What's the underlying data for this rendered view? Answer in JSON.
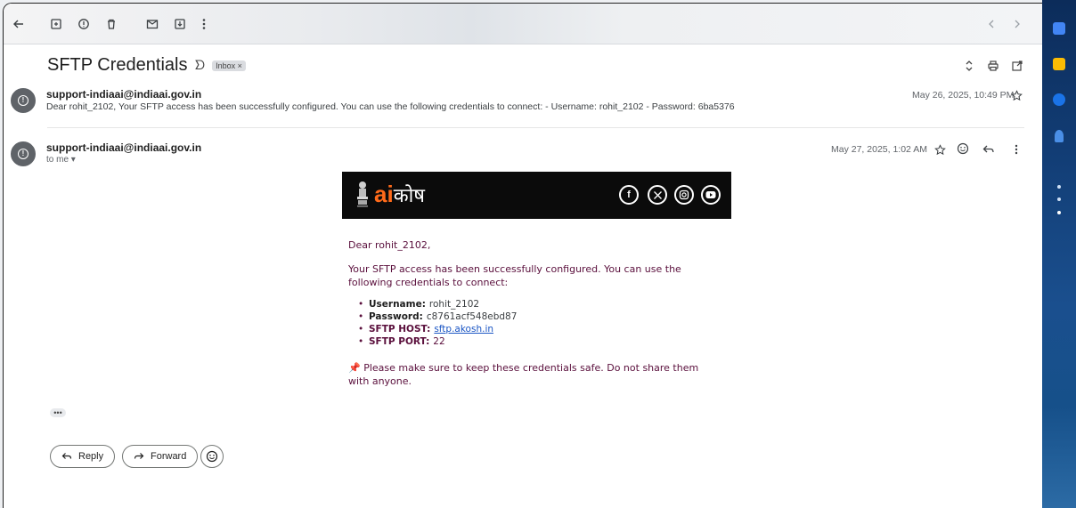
{
  "toolbar": {
    "icons": [
      "back-arrow-icon",
      "archive-icon",
      "report-spam-icon",
      "delete-icon",
      "mark-unread-icon",
      "move-to-icon",
      "more-vert-icon"
    ],
    "nav": [
      "prev-icon",
      "next-icon"
    ]
  },
  "subject": {
    "title": "SFTP Credentials",
    "label": "Inbox ×"
  },
  "message1": {
    "sender": "support-indiaai@indiaai.gov.in",
    "snippet": "Dear rohit_2102, Your SFTP access has been successfully configured. You can use the following credentials to connect: - Username: rohit_2102 - Password: 6ba5376",
    "date": "May 26, 2025, 10:49 PM"
  },
  "message2": {
    "sender": "support-indiaai@indiaai.gov.in",
    "to": "to me ▾",
    "date": "May 27, 2025, 1:02 AM",
    "brand_ai": "ai",
    "brand_kosh": "कोष",
    "greeting": "Dear rohit_2102,",
    "intro": "Your SFTP access has been successfully configured. You can use the following credentials to connect:",
    "credentials": [
      {
        "key": "Username:",
        "value": "rohit_2102"
      },
      {
        "key": "Password:",
        "value": "c8761acf548ebd87"
      },
      {
        "key": "SFTP HOST:",
        "value": "sftp.akosh.in"
      },
      {
        "key": "SFTP PORT:",
        "value": "22"
      }
    ],
    "warning_pin": "📌",
    "warning": "Please make sure to keep these credentials safe. Do not share them with anyone."
  },
  "actions": {
    "reply": "Reply",
    "forward": "Forward",
    "dots": "•••"
  },
  "colors": {
    "body_text": "#5a0f3c",
    "banner_bg": "#0b0b0b",
    "brand_orange": "#ff6a1a",
    "link": "#1a55c4"
  }
}
